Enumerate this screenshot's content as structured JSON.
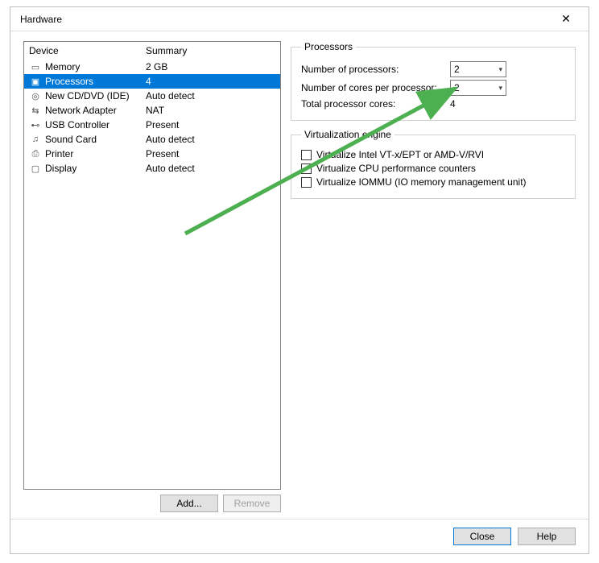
{
  "window": {
    "title": "Hardware"
  },
  "columns": {
    "device": "Device",
    "summary": "Summary"
  },
  "devices": [
    {
      "icon": "memory-icon",
      "glyph": "▭",
      "name": "Memory",
      "summary": "2 GB",
      "selected": false
    },
    {
      "icon": "processor-icon",
      "glyph": "▣",
      "name": "Processors",
      "summary": "4",
      "selected": true
    },
    {
      "icon": "cd-icon",
      "glyph": "◎",
      "name": "New CD/DVD (IDE)",
      "summary": "Auto detect",
      "selected": false
    },
    {
      "icon": "network-icon",
      "glyph": "⇆",
      "name": "Network Adapter",
      "summary": "NAT",
      "selected": false
    },
    {
      "icon": "usb-icon",
      "glyph": "⊷",
      "name": "USB Controller",
      "summary": "Present",
      "selected": false
    },
    {
      "icon": "sound-icon",
      "glyph": "♫",
      "name": "Sound Card",
      "summary": "Auto detect",
      "selected": false
    },
    {
      "icon": "printer-icon",
      "glyph": "⎙",
      "name": "Printer",
      "summary": "Present",
      "selected": false
    },
    {
      "icon": "display-icon",
      "glyph": "▢",
      "name": "Display",
      "summary": "Auto detect",
      "selected": false
    }
  ],
  "buttons": {
    "add": "Add...",
    "remove": "Remove",
    "close": "Close",
    "help": "Help"
  },
  "processors": {
    "legend": "Processors",
    "num_label": "Number of processors:",
    "num_value": "2",
    "cores_label": "Number of cores per processor:",
    "cores_value": "2",
    "total_label": "Total processor cores:",
    "total_value": "4"
  },
  "virtualization": {
    "legend": "Virtualization engine",
    "opt1": "Virtualize Intel VT-x/EPT or AMD-V/RVI",
    "opt2": "Virtualize CPU performance counters",
    "opt3": "Virtualize IOMMU (IO memory management unit)"
  },
  "selected_index": 1
}
